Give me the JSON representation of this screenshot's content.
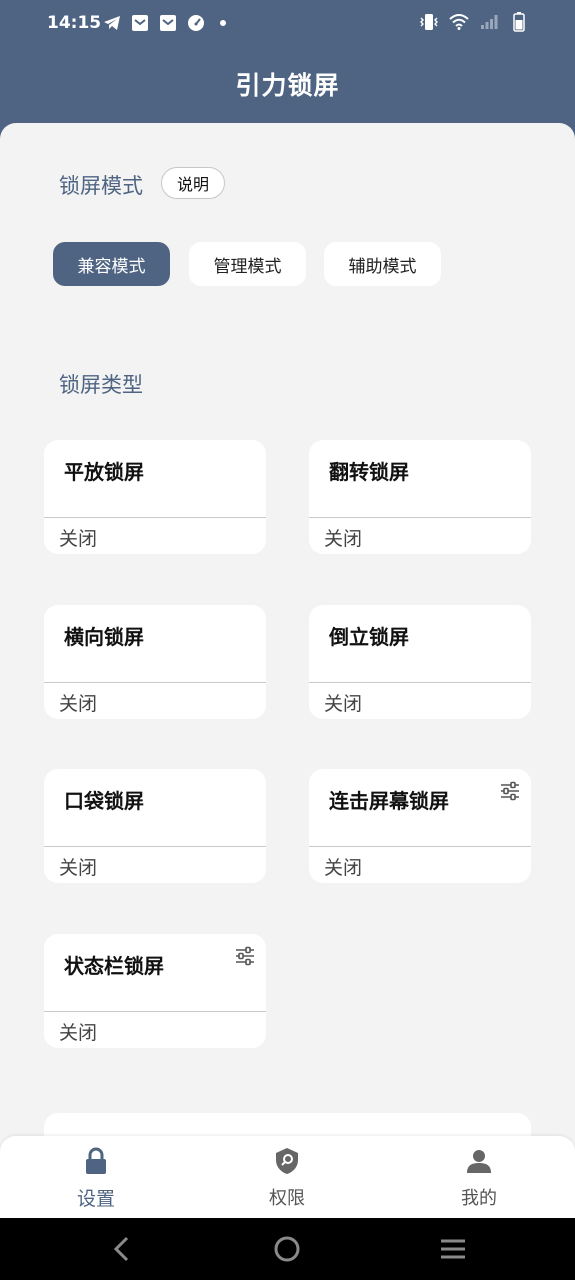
{
  "status_bar": {
    "time": "14:15",
    "left_icons": [
      "telegram-icon",
      "mail-icon",
      "mail-icon",
      "speedometer-icon",
      "notification-dot-icon"
    ],
    "right_icons": [
      "vibrate-icon",
      "wifi-icon",
      "signal-icon",
      "battery-icon"
    ]
  },
  "app_title": "引力锁屏",
  "lock_mode": {
    "title": "锁屏模式",
    "help_button": "说明",
    "modes": [
      {
        "label": "兼容模式",
        "selected": true
      },
      {
        "label": "管理模式",
        "selected": false
      },
      {
        "label": "辅助模式",
        "selected": false
      }
    ]
  },
  "lock_type": {
    "title": "锁屏类型",
    "cards": [
      {
        "title": "平放锁屏",
        "status": "关闭",
        "has_settings": false
      },
      {
        "title": "翻转锁屏",
        "status": "关闭",
        "has_settings": false
      },
      {
        "title": "横向锁屏",
        "status": "关闭",
        "has_settings": false
      },
      {
        "title": "倒立锁屏",
        "status": "关闭",
        "has_settings": false
      },
      {
        "title": "口袋锁屏",
        "status": "关闭",
        "has_settings": false
      },
      {
        "title": "连击屏幕锁屏",
        "status": "关闭",
        "has_settings": true
      },
      {
        "title": "状态栏锁屏",
        "status": "关闭",
        "has_settings": true
      }
    ]
  },
  "bottom_nav": [
    {
      "label": "设置",
      "icon": "lock-icon",
      "active": true
    },
    {
      "label": "权限",
      "icon": "shield-search-icon",
      "active": false
    },
    {
      "label": "我的",
      "icon": "person-icon",
      "active": false
    }
  ],
  "system_nav": [
    "back-icon",
    "home-icon",
    "recents-icon"
  ],
  "colors": {
    "primary": "#4e6482",
    "background": "#f3f3f4",
    "card": "#ffffff"
  }
}
